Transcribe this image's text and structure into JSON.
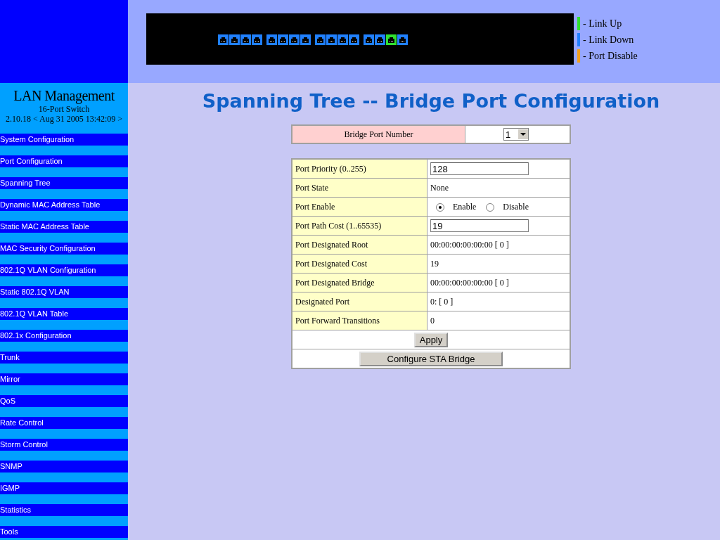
{
  "sidebar": {
    "title": "LAN Management",
    "subtitle": "16-Port Switch",
    "version": "2.10.18 < Aug 31 2005 13:42:09 >",
    "items": [
      {
        "label": "System Configuration",
        "selected": false
      },
      {
        "label": "Port Configuration",
        "selected": false
      },
      {
        "label": "Spanning Tree",
        "selected": false
      },
      {
        "label": "Dynamic MAC Address Table",
        "selected": false
      },
      {
        "label": "Static MAC Address Table",
        "selected": false
      },
      {
        "label": "MAC Security Configuration",
        "selected": false
      },
      {
        "label": "802.1Q VLAN Configuration",
        "selected": false
      },
      {
        "label": "Static 802.1Q VLAN",
        "selected": false
      },
      {
        "label": "802.1Q VLAN Table",
        "selected": false
      },
      {
        "label": "802.1x Configuration",
        "selected": false
      },
      {
        "label": "Trunk",
        "selected": false
      },
      {
        "label": "Mirror",
        "selected": false
      },
      {
        "label": "QoS",
        "selected": false
      },
      {
        "label": "Rate Control",
        "selected": false
      },
      {
        "label": "Storm Control",
        "selected": false
      },
      {
        "label": "SNMP",
        "selected": false
      },
      {
        "label": "IGMP",
        "selected": false
      },
      {
        "label": "Statistics",
        "selected": false
      },
      {
        "label": "Tools",
        "selected": false
      }
    ]
  },
  "ports": [
    {
      "color": "#2080ff"
    },
    {
      "color": "#2080ff"
    },
    {
      "color": "#2080ff"
    },
    {
      "color": "#2080ff"
    },
    {
      "color": "#2080ff"
    },
    {
      "color": "#2080ff"
    },
    {
      "color": "#2080ff"
    },
    {
      "color": "#2080ff"
    },
    {
      "color": "#2080ff"
    },
    {
      "color": "#2080ff"
    },
    {
      "color": "#2080ff"
    },
    {
      "color": "#2080ff"
    },
    {
      "color": "#2080ff"
    },
    {
      "color": "#2080ff"
    },
    {
      "color": "#30e030"
    },
    {
      "color": "#2080ff"
    }
  ],
  "legend": [
    {
      "label": "- Link Up",
      "color": "#30e030"
    },
    {
      "label": "- Link Down",
      "color": "#2080ff"
    },
    {
      "label": "- Port Disable",
      "color": "#f0a020"
    }
  ],
  "page_title": "Spanning Tree -- Bridge Port Configuration",
  "bridge_port": {
    "label": "Bridge Port Number",
    "value": "1"
  },
  "rows": [
    {
      "kind": "input",
      "label": "Port Priority (0..255)",
      "value": "128"
    },
    {
      "kind": "text",
      "label": "Port State",
      "value": "None"
    },
    {
      "kind": "radio",
      "label": "Port Enable",
      "options": [
        {
          "label": "Enable",
          "selected": true
        },
        {
          "label": "Disable",
          "selected": false
        }
      ]
    },
    {
      "kind": "input",
      "label": "Port Path Cost (1..65535)",
      "value": "19"
    },
    {
      "kind": "text",
      "label": "Port Designated Root",
      "value": "00:00:00:00:00:00 [ 0 ]"
    },
    {
      "kind": "text",
      "label": "Port Designated Cost",
      "value": "19"
    },
    {
      "kind": "text",
      "label": "Port Designated Bridge",
      "value": "00:00:00:00:00:00 [ 0 ]"
    },
    {
      "kind": "text",
      "label": "Designated Port",
      "value": "0: [ 0 ]"
    },
    {
      "kind": "text",
      "label": "Port Forward Transitions",
      "value": "0"
    }
  ],
  "buttons": {
    "apply": "Apply",
    "configure": "Configure STA Bridge"
  }
}
